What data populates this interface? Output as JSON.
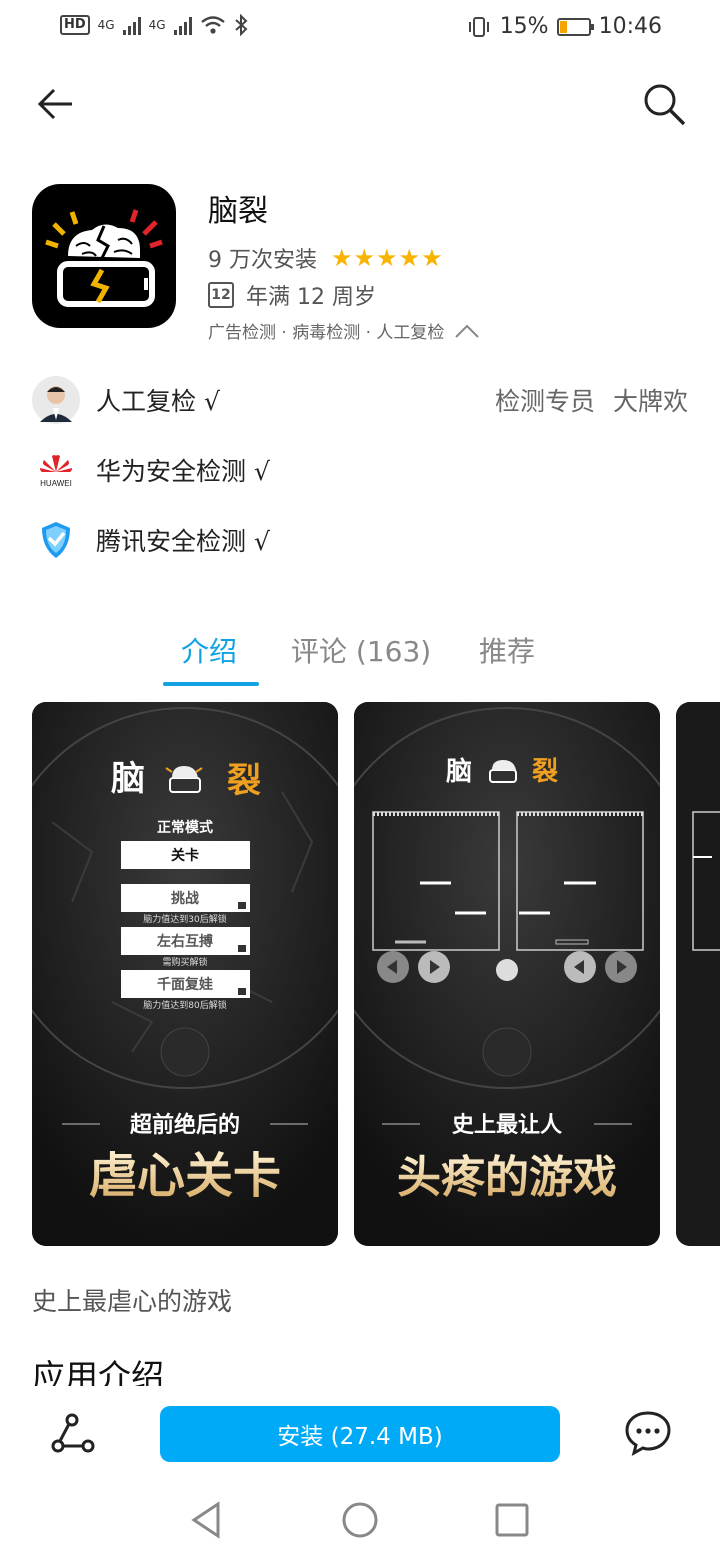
{
  "status_bar": {
    "hd_tag": "HD",
    "net1": "4G",
    "net2": "4G",
    "battery_percent_text": "15%",
    "battery_level": 0.15,
    "time": "10:46"
  },
  "nav": {
    "back_icon": "arrow-left-icon",
    "search_icon": "search-icon"
  },
  "app": {
    "name": "脑裂",
    "installs": "9 万次安装",
    "stars": "★★★★★",
    "rating": 5,
    "age_badge": "12",
    "age_text": "年满 12 周岁",
    "checks": "广告检测 · 病毒检测 · 人工复检"
  },
  "verification": {
    "manual": {
      "label": "人工复检 √",
      "role": "检测专员",
      "name": "大牌欢"
    },
    "huawei": {
      "label": "华为安全检测 √",
      "logo_text": "HUAWEI"
    },
    "tencent": {
      "label": "腾讯安全检测 √"
    }
  },
  "tabs": [
    {
      "label": "介绍",
      "active": true
    },
    {
      "label": "评论 (163)",
      "active": false
    },
    {
      "label": "推荐",
      "active": false
    }
  ],
  "screenshots": [
    {
      "title_left": "脑",
      "title_right": "裂",
      "mode": "正常模式",
      "menu": [
        {
          "label": "关卡",
          "note": ""
        },
        {
          "label": "挑战",
          "note": "脑力值达到30后解锁"
        },
        {
          "label": "左右互搏",
          "note": "需购买解锁"
        },
        {
          "label": "千面复娃",
          "note": "脑力值达到80后解锁"
        }
      ],
      "caption_small": "超前绝后的",
      "caption_big": "虐心关卡"
    },
    {
      "title_left": "脑",
      "title_right": "裂",
      "caption_small": "史上最让人",
      "caption_big": "头疼的游戏"
    }
  ],
  "description": "史上最虐心的游戏",
  "section_title": "应用介绍",
  "bottom": {
    "install_label": "安装 (27.4 MB)",
    "share_icon": "share-icon",
    "comment_icon": "chat-bubble-icon"
  },
  "colors": {
    "accent": "#11a2e3",
    "install_button": "#00aaf7",
    "stars": "#f7b500",
    "battery": "#f6a400"
  }
}
